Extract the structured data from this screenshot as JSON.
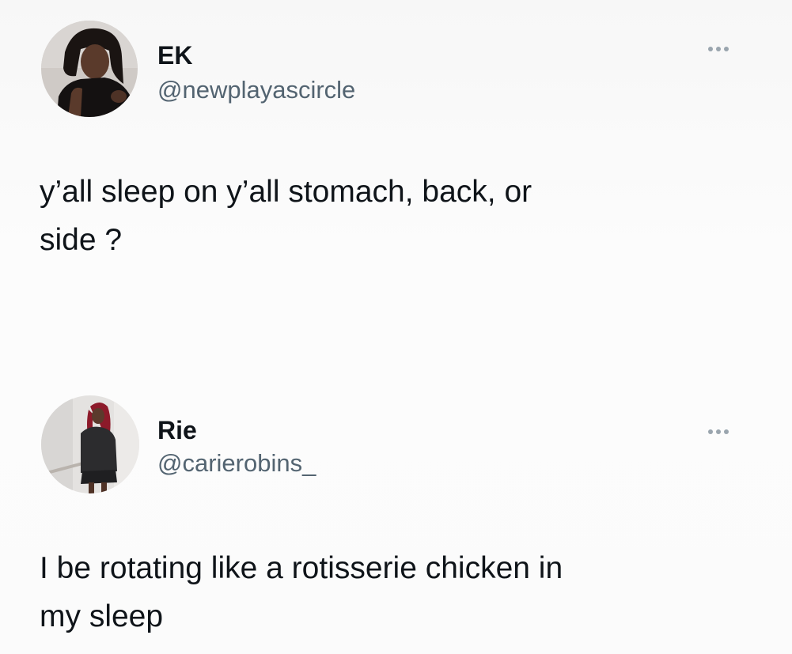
{
  "tweets": [
    {
      "display_name": "EK",
      "handle": "@newplayascircle",
      "text": "y’all sleep on y’all stomach, back, or\nside ?",
      "avatar_icon": "profile-photo-icon",
      "more_icon": "more-options-icon"
    },
    {
      "display_name": "Rie",
      "handle": "@carierobins_",
      "text": "I be rotating like a rotisserie chicken in\nmy sleep",
      "avatar_icon": "profile-photo-icon",
      "more_icon": "more-options-icon"
    }
  ],
  "colors": {
    "text_primary": "#0f1419",
    "text_secondary": "#536471",
    "more_dots": "#9aa5ae"
  }
}
